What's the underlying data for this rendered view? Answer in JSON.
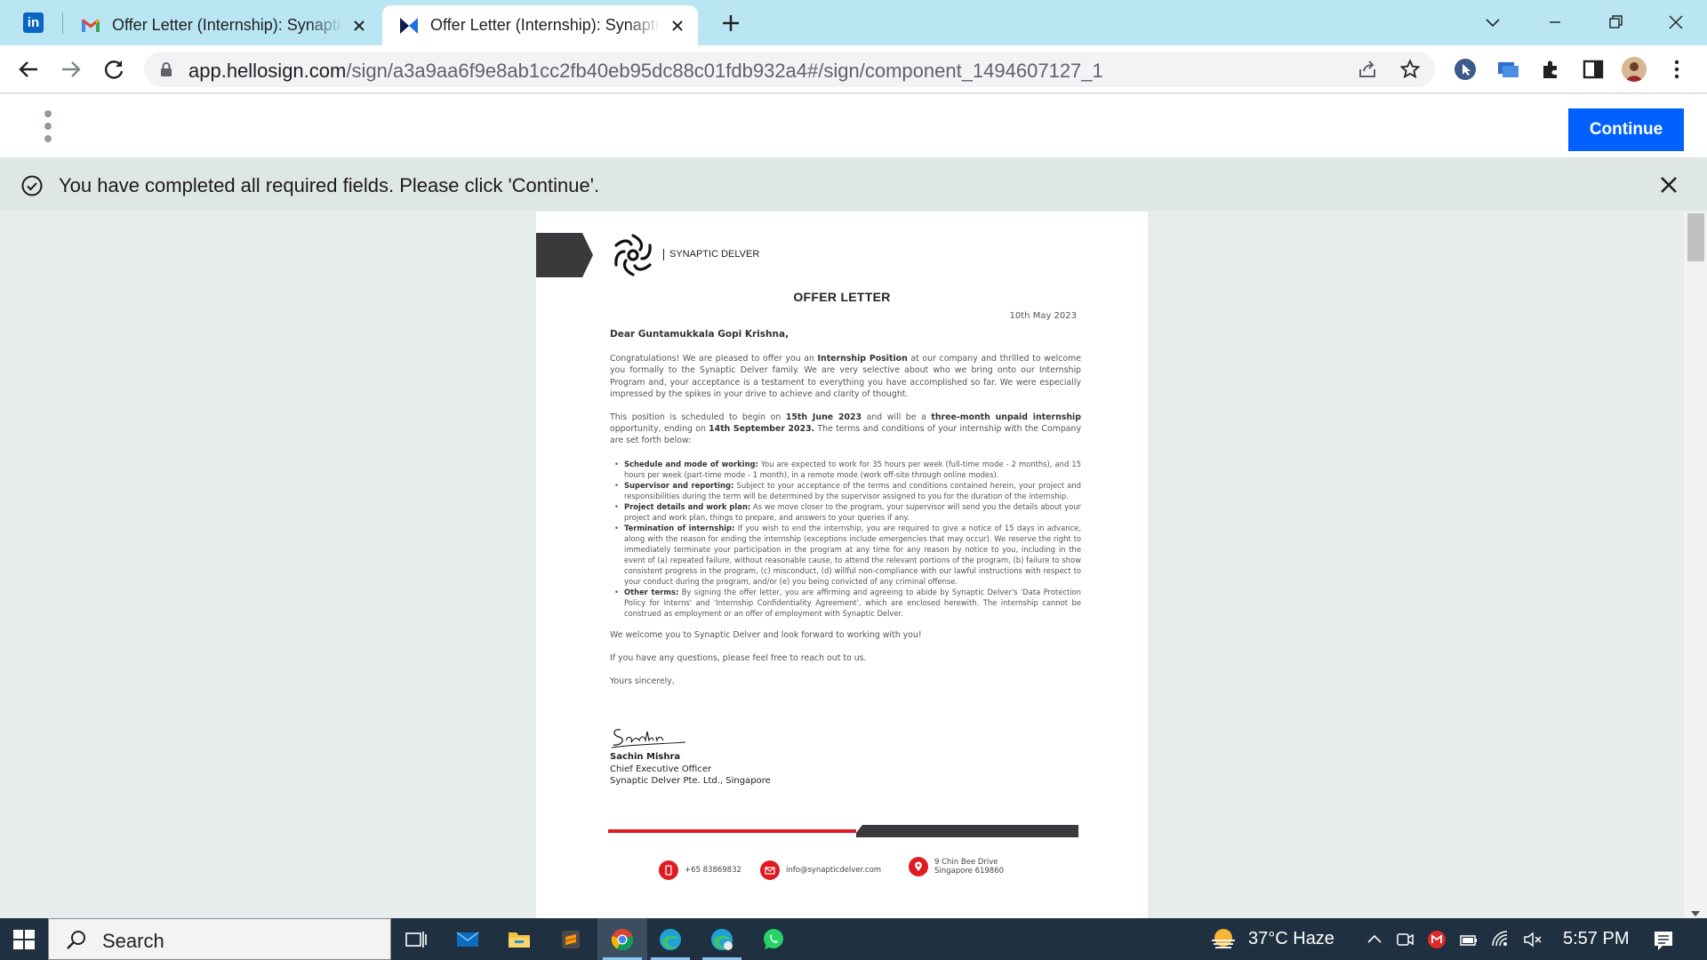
{
  "browser": {
    "tabs": [
      {
        "title": "Offer Letter (Internship): Synaptic Delver",
        "favicon": "gmail-icon"
      },
      {
        "title": "Offer Letter (Internship): Synaptic Delver",
        "favicon": "hellosign-icon"
      }
    ],
    "pinned_tab": {
      "label": "in",
      "favicon": "linkedin-icon"
    },
    "url": {
      "host": "app.hellosign.com",
      "path": "/sign/a3a9aa6f9e8ab1cc2fb40eb95dc88c01fdb932a4#/sign/component_1494607127_1"
    }
  },
  "hellosign": {
    "continue_label": "Continue",
    "notice": "You have completed all required fields. Please click 'Continue'."
  },
  "letter": {
    "brand": "SYNAPTIC DELVER",
    "title": "OFFER LETTER",
    "date": "10th May 2023",
    "salutation": "Dear Guntamukkala Gopi Krishna,",
    "p1": {
      "a": "Congratulations! We are pleased to offer you an ",
      "b": "Internship Position",
      "c": " at our company and thrilled to welcome you formally to the Synaptic Delver family. We are very selective about who we bring onto our Internship Program and, your acceptance is a testament to everything you have accomplished so far. We were especially impressed by the spikes in your drive to achieve and clarity of thought."
    },
    "p2": {
      "a": "This position is scheduled to begin on ",
      "b": "15th June 2023",
      "c": " and will be a ",
      "d": "three-month unpaid internship",
      "e": " opportunity, ending on ",
      "f": "14th September 2023.",
      "g": " The terms and conditions of your internship with the Company are set forth below:"
    },
    "terms": [
      {
        "head": "Schedule and mode of working:",
        "text": " You are expected to work for 35 hours per week (full-time mode - 2 months), and 15 hours per week (part-time mode - 1 month), in a remote mode (work off-site through online modes)."
      },
      {
        "head": "Supervisor and reporting:",
        "text": " Subject to your acceptance of the terms and conditions contained herein, your project and responsibilities during the term will be determined by the supervisor assigned to you for the duration of the internship."
      },
      {
        "head": "Project details and work plan:",
        "text": " As we move closer to the program, your supervisor will send you the details about your project and work plan, things to prepare, and answers to your queries if any."
      },
      {
        "head": "Termination of internship:",
        "text": " If you wish to end the internship, you are required to give a notice of 15 days in advance, along with the reason for ending the internship (exceptions include emergencies that may occur). We reserve the right to immediately terminate your participation in the program at any time for any reason by notice to you, including in the event of (a) repeated failure, without reasonable cause, to attend the relevant portions of the program, (b) failure to show consistent progress in the program, (c) misconduct, (d) willful non-compliance with our lawful instructions with respect to your conduct during the program, and/or (e) you being convicted of any criminal offense."
      },
      {
        "head": "Other terms:",
        "text": " By signing the offer letter, you are affirming and agreeing to abide by Synaptic Delver's 'Data Protection Policy for Interns' and 'Internship Confidentiality Agreement', which are enclosed herewith. The internship cannot be construed as employment or an offer of employment with Synaptic Delver."
      }
    ],
    "welcome": "We welcome you to Synaptic Delver and look forward to working with you!",
    "questions": "If you have any questions, please feel free to reach out to us.",
    "closing": "Yours sincerely,",
    "signature": "Sachin",
    "signer_name": "Sachin Mishra",
    "signer_title": "Chief Executive Officer",
    "signer_company": "Synaptic Delver Pte. Ltd., Singapore",
    "contact_phone": "+65 83869832",
    "contact_email": "info@synapticdelver.com",
    "contact_addr1": "9 Chin Bee Drive",
    "contact_addr2": "Singapore 619860"
  },
  "taskbar": {
    "search_label": "Search",
    "weather": "37°C  Haze",
    "time": "5:57 PM"
  },
  "colors": {
    "accent": "#0061fe",
    "tabstrip": "#b9e6f2",
    "notice_bg": "#dfe7e4",
    "brand_red": "#e11b22"
  }
}
